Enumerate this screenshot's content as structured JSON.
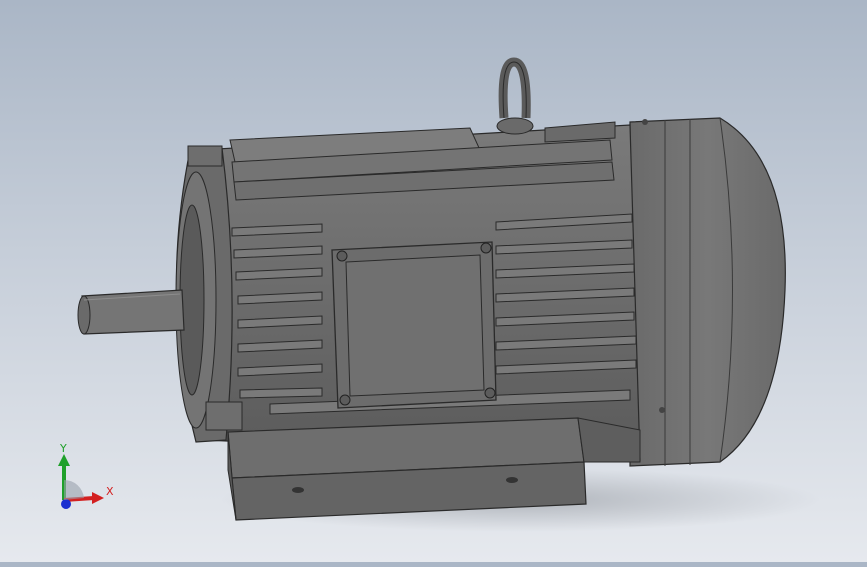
{
  "viewport": {
    "background_top": "#aab6c6",
    "background_bottom": "#e6e9ee",
    "model_color": "#6e6e6e"
  },
  "triad": {
    "x_label": "X",
    "y_label": "Y",
    "x_color": "#d32020",
    "y_color": "#1fa02a",
    "z_color": "#1b2fd0"
  }
}
